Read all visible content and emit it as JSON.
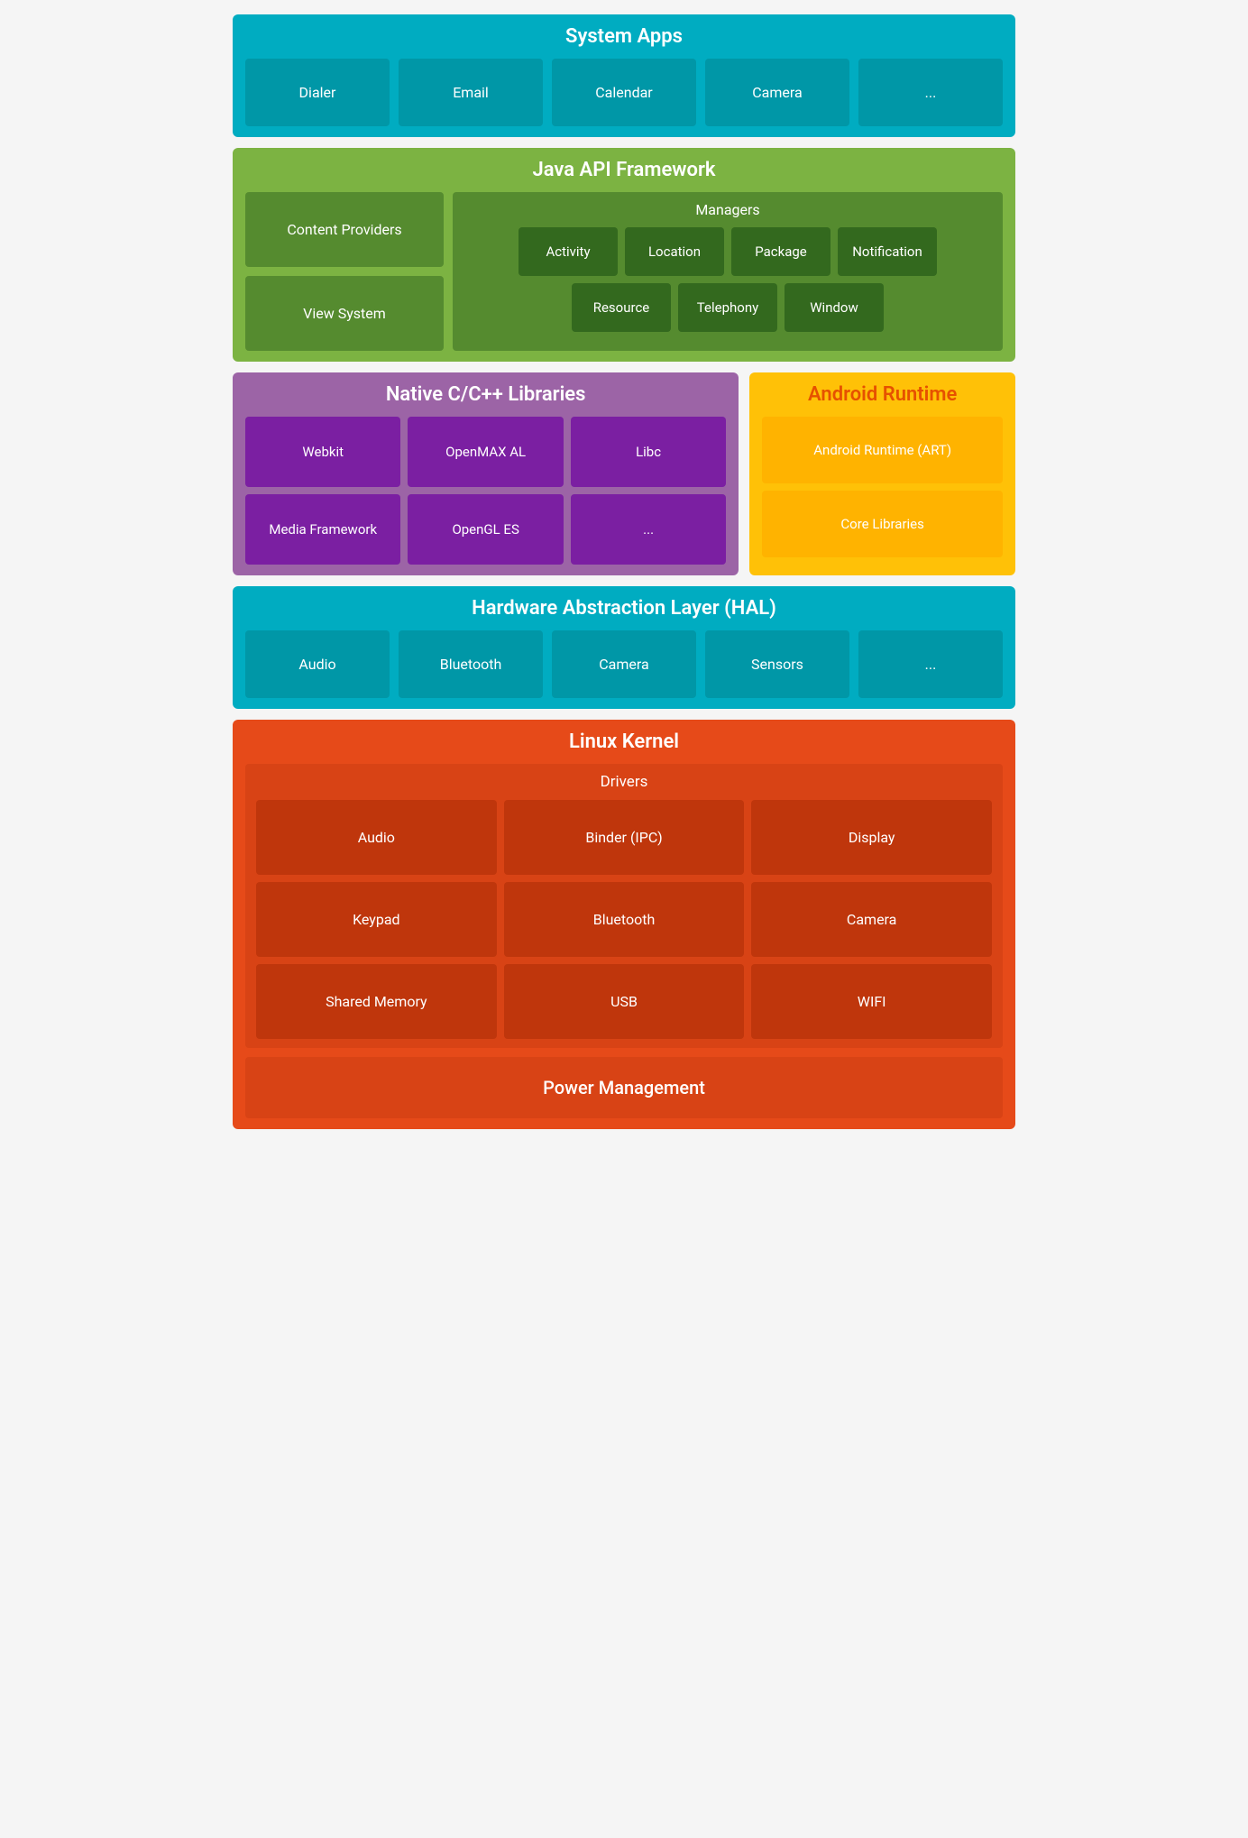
{
  "system_apps": {
    "title": "System Apps",
    "items": [
      "Dialer",
      "Email",
      "Calendar",
      "Camera",
      "..."
    ]
  },
  "java_api": {
    "title": "Java API Framework",
    "left": [
      "Content Providers",
      "View System"
    ],
    "managers": {
      "title": "Managers",
      "row1": [
        "Activity",
        "Location",
        "Package",
        "Notification"
      ],
      "row2": [
        "Resource",
        "Telephony",
        "Window"
      ]
    }
  },
  "native_cpp": {
    "title": "Native C/C++ Libraries",
    "items": [
      "Webkit",
      "OpenMAX AL",
      "Libc",
      "Media Framework",
      "OpenGL ES",
      "..."
    ]
  },
  "android_runtime": {
    "title": "Android Runtime",
    "items": [
      "Android Runtime (ART)",
      "Core Libraries"
    ]
  },
  "hal": {
    "title": "Hardware Abstraction Layer (HAL)",
    "items": [
      "Audio",
      "Bluetooth",
      "Camera",
      "Sensors",
      "..."
    ]
  },
  "linux_kernel": {
    "title": "Linux Kernel",
    "drivers_title": "Drivers",
    "drivers": [
      "Audio",
      "Binder (IPC)",
      "Display",
      "Keypad",
      "Bluetooth",
      "Camera",
      "Shared Memory",
      "USB",
      "WIFI"
    ],
    "power_mgmt": "Power Management"
  }
}
